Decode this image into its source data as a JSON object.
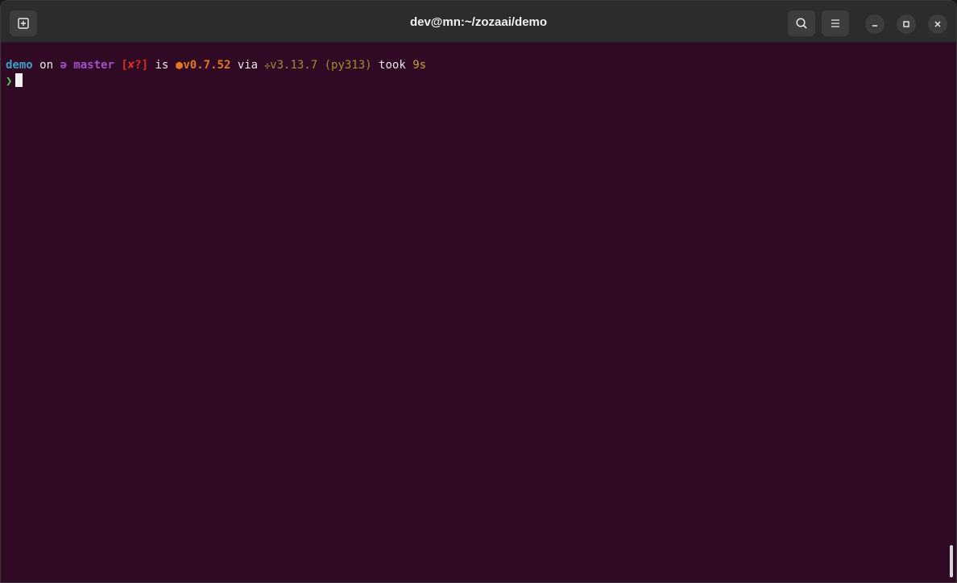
{
  "window": {
    "title": "dev@mn:~/zozaai/demo"
  },
  "titlebar": {
    "new_tab_icon": "new-tab-icon",
    "search_icon": "search-icon",
    "menu_icon": "hamburger-menu-icon",
    "minimize_icon": "minimize-icon",
    "maximize_icon": "maximize-icon",
    "close_icon": "close-icon"
  },
  "terminal": {
    "prompt_line": {
      "dir": "demo",
      "on": " on ",
      "branch_glyph": "ə",
      "branch": " master",
      "status": " [✘?]",
      "is": " is ",
      "pkg_glyph": "📦",
      "pkg_version": "v0.7.52",
      "via": " via ",
      "py_glyph": "🐍",
      "py_version": "v3.13.7 (py313)",
      "took": " took ",
      "duration": "9s"
    },
    "prompt_symbol": "❯"
  },
  "colors": {
    "terminal_bg": "#300a24",
    "titlebar_bg": "#2c2c2c",
    "dir": "#3aa0c8",
    "branch": "#a050c8",
    "status": "#d83020",
    "pkg": "#e07820",
    "python": "#a68a30",
    "prompt": "#4ec94e"
  }
}
